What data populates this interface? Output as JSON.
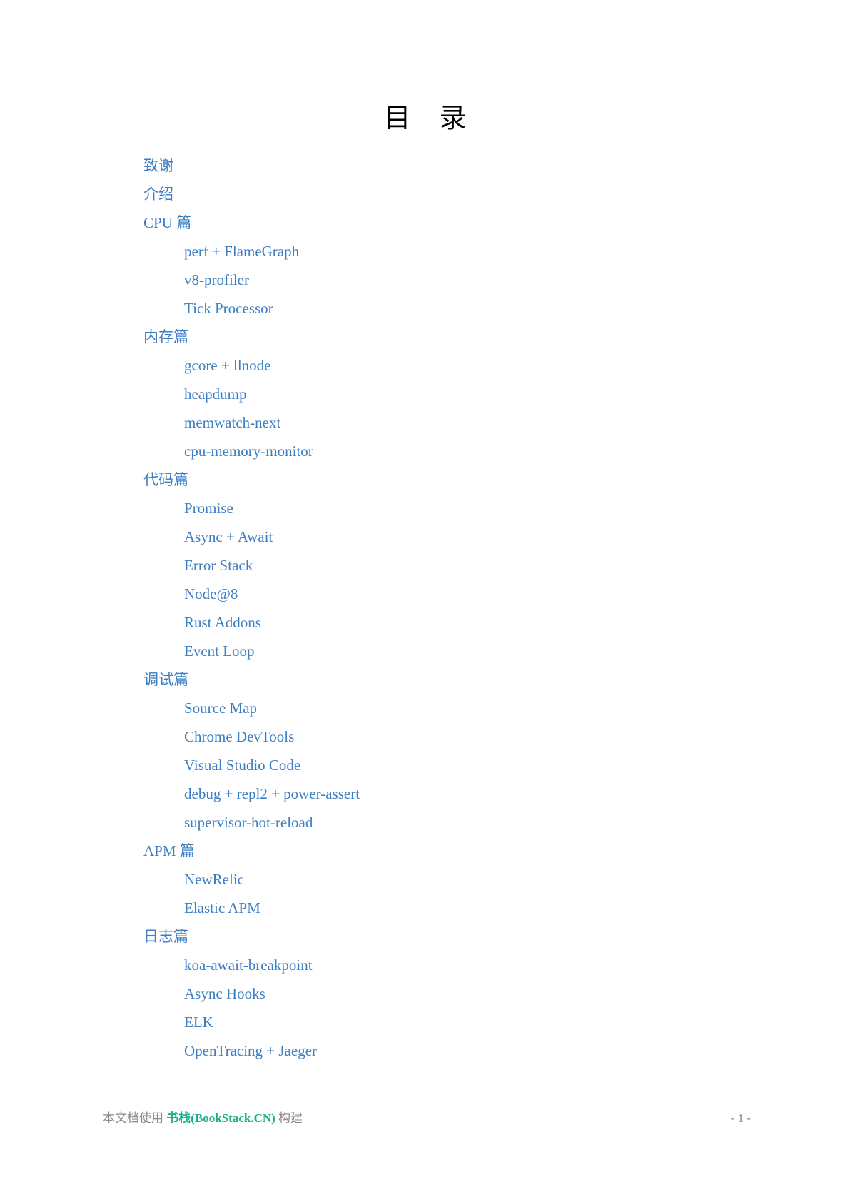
{
  "title": "目录",
  "toc": [
    {
      "level": 1,
      "label": "致谢"
    },
    {
      "level": 1,
      "label": "介绍"
    },
    {
      "level": 1,
      "label": "CPU 篇"
    },
    {
      "level": 2,
      "label": "perf + FlameGraph"
    },
    {
      "level": 2,
      "label": "v8-profiler"
    },
    {
      "level": 2,
      "label": "Tick Processor"
    },
    {
      "level": 1,
      "label": "内存篇"
    },
    {
      "level": 2,
      "label": "gcore + llnode"
    },
    {
      "level": 2,
      "label": "heapdump"
    },
    {
      "level": 2,
      "label": "memwatch-next"
    },
    {
      "level": 2,
      "label": "cpu-memory-monitor"
    },
    {
      "level": 1,
      "label": "代码篇"
    },
    {
      "level": 2,
      "label": "Promise"
    },
    {
      "level": 2,
      "label": "Async + Await"
    },
    {
      "level": 2,
      "label": "Error Stack"
    },
    {
      "level": 2,
      "label": "Node@8"
    },
    {
      "level": 2,
      "label": "Rust Addons"
    },
    {
      "level": 2,
      "label": "Event Loop"
    },
    {
      "level": 1,
      "label": "调试篇"
    },
    {
      "level": 2,
      "label": "Source Map"
    },
    {
      "level": 2,
      "label": "Chrome DevTools"
    },
    {
      "level": 2,
      "label": "Visual Studio Code"
    },
    {
      "level": 2,
      "label": "debug + repl2 + power-assert"
    },
    {
      "level": 2,
      "label": "supervisor-hot-reload"
    },
    {
      "level": 1,
      "label": "APM 篇"
    },
    {
      "level": 2,
      "label": "NewRelic"
    },
    {
      "level": 2,
      "label": "Elastic APM"
    },
    {
      "level": 1,
      "label": "日志篇"
    },
    {
      "level": 2,
      "label": "koa-await-breakpoint"
    },
    {
      "level": 2,
      "label": "Async Hooks"
    },
    {
      "level": 2,
      "label": "ELK"
    },
    {
      "level": 2,
      "label": "OpenTracing + Jaeger"
    }
  ],
  "footer": {
    "prefix": "本文档使用",
    "brand": "书栈(BookStack.CN)",
    "suffix": "构建",
    "page": "- 1 -"
  },
  "colors": {
    "link": "#3d7ec3",
    "brand": "#19b28a",
    "footer_text": "#8a8a8a"
  }
}
